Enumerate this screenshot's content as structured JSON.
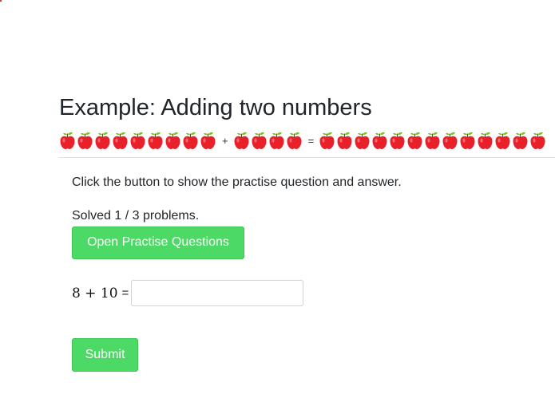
{
  "example": {
    "title": "Example: Adding two numbers",
    "left_count": 9,
    "right_count": 4,
    "result_count": 13,
    "plus_sign": "+",
    "equals_sign": "=",
    "apple_icon": "apple-icon",
    "apple_color": "#e8202a",
    "leaf_color": "#7dbf2a"
  },
  "panel": {
    "instructions": "Click the button to show the practise question and answer.",
    "solved_status": "Solved 1 / 3 problems.",
    "open_button_label": "Open Practise Questions",
    "question": {
      "operand_a": "8",
      "operator": "+",
      "operand_b": "10",
      "equals": "=",
      "answer_value": ""
    },
    "submit_label": "Submit",
    "button_color": "#4cd965"
  }
}
